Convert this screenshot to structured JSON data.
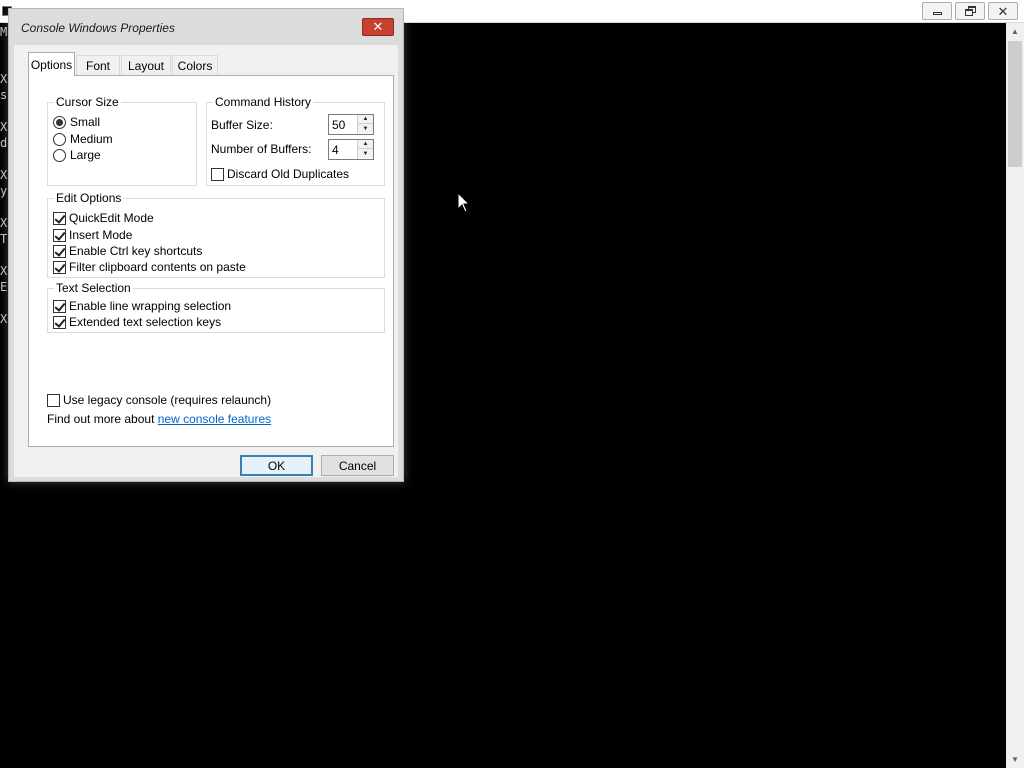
{
  "console": {
    "edge_chars": [
      "M",
      "X",
      "s",
      "X",
      "d",
      "X",
      "y",
      "X",
      "T",
      "X",
      "E",
      "X"
    ]
  },
  "dialog": {
    "title": "Console Windows Properties",
    "close_glyph": "✕",
    "tabs": [
      {
        "label": "Options",
        "active": true
      },
      {
        "label": "Font",
        "active": false
      },
      {
        "label": "Layout",
        "active": false
      },
      {
        "label": "Colors",
        "active": false
      }
    ],
    "cursor_size": {
      "legend": "Cursor Size",
      "options": [
        {
          "label": "Small",
          "selected": true
        },
        {
          "label": "Medium",
          "selected": false
        },
        {
          "label": "Large",
          "selected": false
        }
      ]
    },
    "command_history": {
      "legend": "Command History",
      "buffer_size_label": "Buffer Size:",
      "buffer_size_value": "50",
      "num_buffers_label": "Number of Buffers:",
      "num_buffers_value": "4",
      "discard_label": "Discard Old Duplicates",
      "discard_checked": false
    },
    "edit_options": {
      "legend": "Edit Options",
      "items": [
        {
          "label": "QuickEdit Mode",
          "checked": true
        },
        {
          "label": "Insert Mode",
          "checked": true
        },
        {
          "label": "Enable Ctrl key shortcuts",
          "checked": true
        },
        {
          "label": "Filter clipboard contents on paste",
          "checked": true
        }
      ]
    },
    "text_selection": {
      "legend": "Text Selection",
      "items": [
        {
          "label": "Enable line wrapping selection",
          "checked": true
        },
        {
          "label": "Extended text selection keys",
          "checked": true
        }
      ]
    },
    "legacy": {
      "label": "Use legacy console (requires relaunch)",
      "checked": false
    },
    "find_out": {
      "prefix": "Find out more about ",
      "link": "new console features"
    },
    "buttons": {
      "ok": "OK",
      "cancel": "Cancel"
    }
  }
}
